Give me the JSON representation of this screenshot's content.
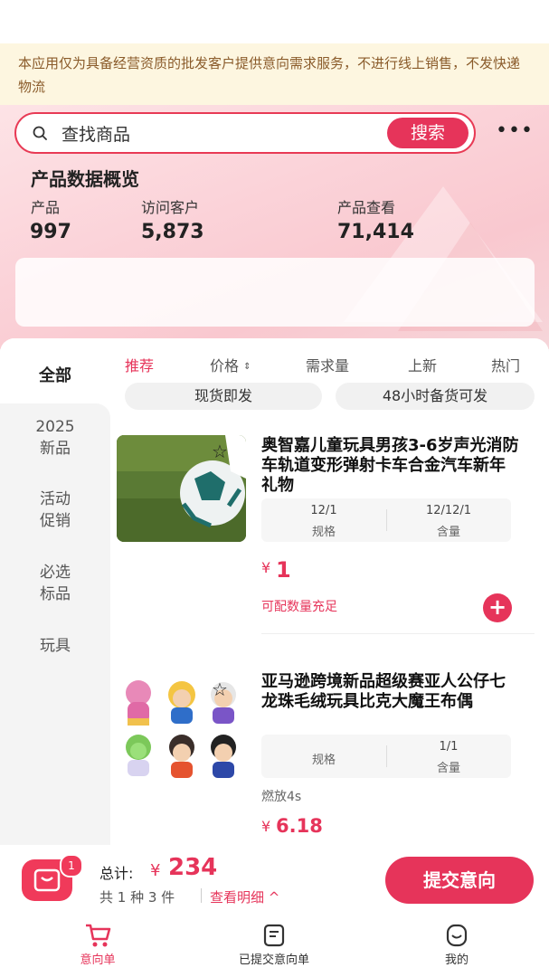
{
  "notice": "本应用仅为具备经营资质的批发客户提供意向需求服务，不进行线上销售，不发快递物流",
  "search": {
    "placeholder": "查找商品",
    "button": "搜索"
  },
  "overview": {
    "title": "产品数据概览",
    "stats": [
      {
        "label": "产品",
        "value": "997"
      },
      {
        "label": "访问客户",
        "value": "5,873"
      },
      {
        "label": "产品查看",
        "value": "71,414"
      }
    ]
  },
  "categories": [
    "全部",
    "2025\n新品",
    "活动\n促销",
    "必选\n标品",
    "玩具"
  ],
  "sort_tabs": [
    "推荐",
    "价格",
    "需求量",
    "上新",
    "热门"
  ],
  "filter_chips": [
    "现货即发",
    "48小时备货可发"
  ],
  "products": [
    {
      "title": "奥智嘉儿童玩具男孩3-6岁声光消防车轨道变形弹射卡车合金汽车新年礼物",
      "spec_left_value": "12/1",
      "spec_left_label": "规格",
      "spec_right_value": "12/12/1",
      "spec_right_label": "含量",
      "price_symbol": "¥",
      "price": "1",
      "stock": "可配数量充足"
    },
    {
      "title": "亚马逊跨境新品超级赛亚人公仔七龙珠毛绒玩具比克大魔王布偶",
      "spec_left_value": "",
      "spec_left_label": "规格",
      "spec_right_value": "1/1",
      "spec_right_label": "含量",
      "note": "燃放4s",
      "price_symbol": "¥",
      "price": "6.18"
    }
  ],
  "cart": {
    "badge": "1",
    "total_label": "总计:",
    "total_symbol": "¥",
    "total": "234",
    "summary": "共 1 种 3 件",
    "detail_link": "查看明细 ^",
    "submit": "提交意向"
  },
  "tabbar": [
    "意向单",
    "已提交意向单",
    "我的"
  ],
  "colors": {
    "accent": "#e6345a",
    "notice_bg": "#fdf6e0",
    "notice_text": "#8a5b2a"
  }
}
